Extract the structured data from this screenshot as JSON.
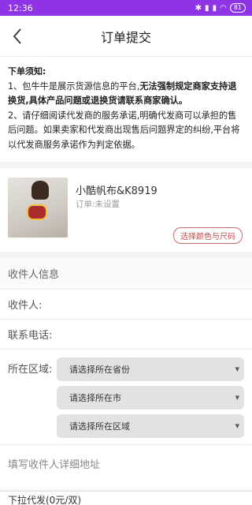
{
  "status": {
    "time": "12:36",
    "battery": "81"
  },
  "nav": {
    "title": "订单提交"
  },
  "notice": {
    "title": "下单须知:",
    "p1_a": "1、包牛牛是展示货源信息的平台,",
    "p1_b": "无法强制规定商家支持退换货,具体产品问题或退换货请联系商家确认。",
    "p2": "2、请仔细阅读代发商的服务承诺,明确代发商可以承担的售后问题。如果卖家和代发商出现售后问题界定的纠纷,平台将以代发商服务承诺作为判定依据。"
  },
  "product": {
    "name": "小酷帆布&K8919",
    "spec": "订单:未设置",
    "choose_button": "选择颜色与尺码"
  },
  "form": {
    "section_title": "收件人信息",
    "recipient_label": "收件人:",
    "phone_label": "联系电话:",
    "area_label": "所在区域:",
    "province_placeholder": "请选择所在省份",
    "city_placeholder": "请选择所在市",
    "district_placeholder": "请选择所在区域",
    "address_placeholder": "填写收件人详细地址"
  },
  "bottom": {
    "text": "下拉代发(0元/双)"
  }
}
